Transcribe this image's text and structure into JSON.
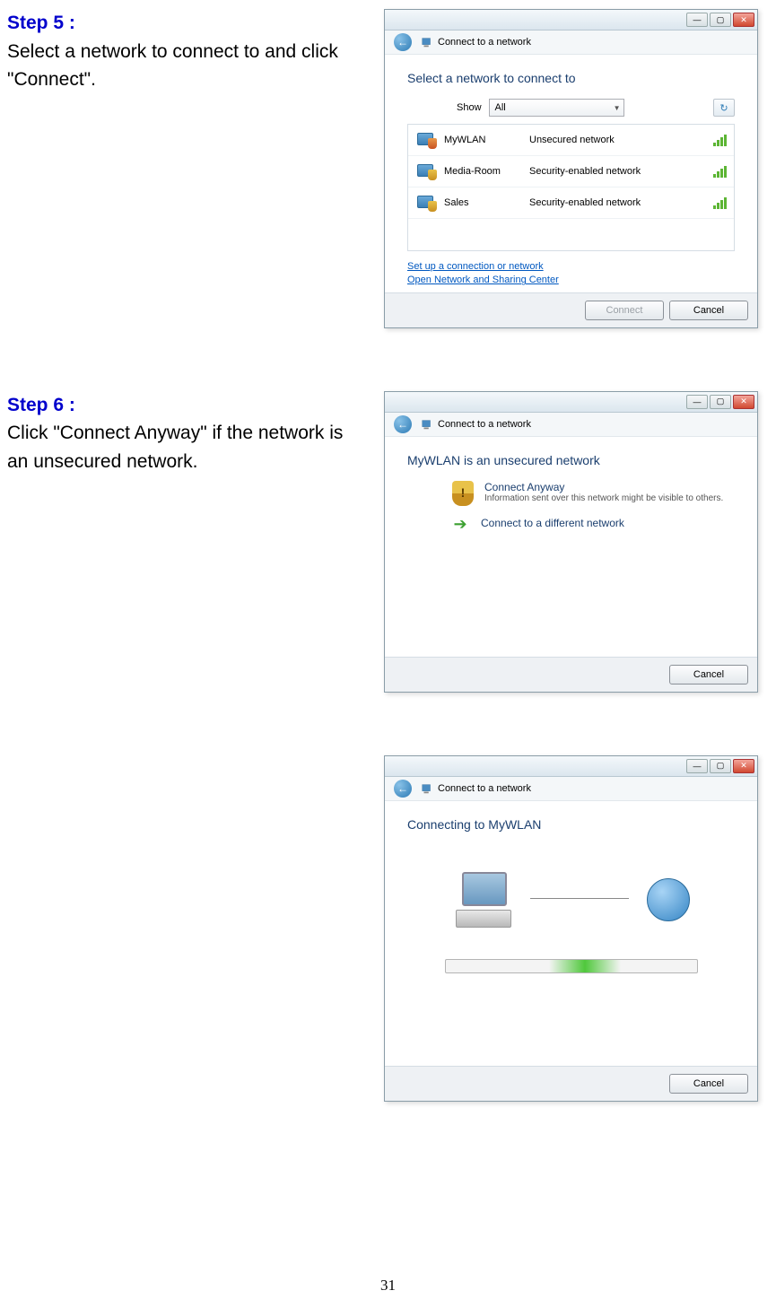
{
  "step5": {
    "label": "Step 5 :",
    "desc": "Select a network to connect to and click \"Connect\"."
  },
  "step6": {
    "label": "Step 6 :",
    "desc": "Click \"Connect Anyway\" if the network is an unsecured network."
  },
  "dialog1": {
    "header": "Connect to a network",
    "title": "Select a network to connect to",
    "show_label": "Show",
    "show_value": "All",
    "networks": [
      {
        "name": "MyWLAN",
        "status": "Unsecured network"
      },
      {
        "name": "Media-Room",
        "status": "Security-enabled network"
      },
      {
        "name": "Sales",
        "status": "Security-enabled network"
      }
    ],
    "link1": "Set up a connection or network",
    "link2": "Open Network and Sharing Center",
    "connect": "Connect",
    "cancel": "Cancel"
  },
  "dialog2": {
    "header": "Connect to a network",
    "title": "MyWLAN is an unsecured network",
    "opt1_title": "Connect Anyway",
    "opt1_sub": "Information sent over this network might be visible to others.",
    "opt2_title": "Connect to a different network",
    "cancel": "Cancel"
  },
  "dialog3": {
    "header": "Connect to a network",
    "title": "Connecting to MyWLAN",
    "cancel": "Cancel"
  },
  "page_number": "31"
}
